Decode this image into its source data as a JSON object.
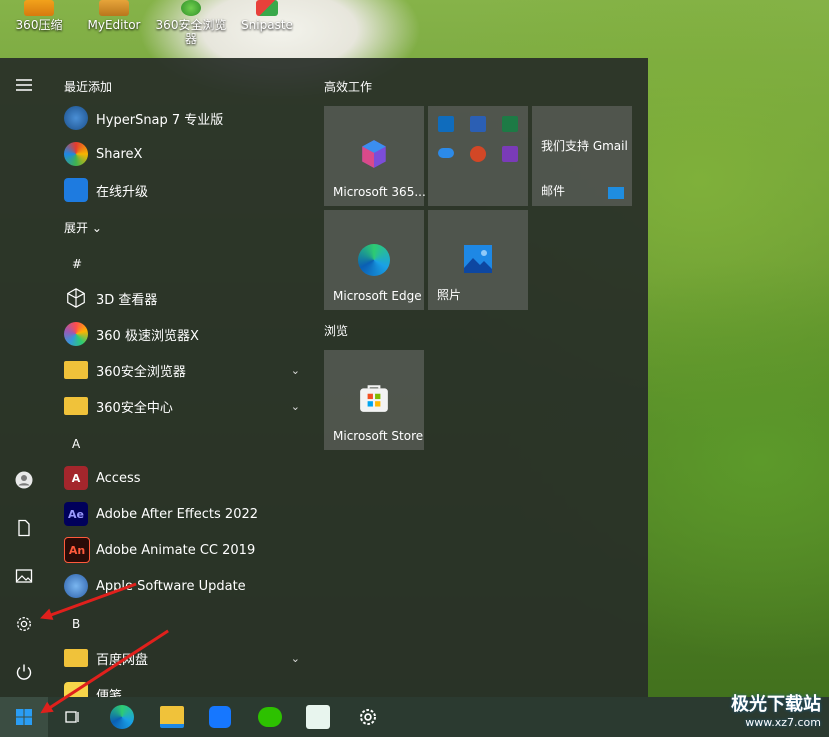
{
  "desktop": {
    "icons": [
      {
        "label": "360压缩",
        "icon": "archive-icon"
      },
      {
        "label": "MyEditor",
        "icon": "editor-icon"
      },
      {
        "label": "360安全浏览器",
        "icon": "browser-icon"
      },
      {
        "label": "Snipaste",
        "icon": "snipaste-icon"
      }
    ]
  },
  "start_menu": {
    "recent_label": "最近添加",
    "recent_apps": [
      {
        "label": "HyperSnap 7 专业版",
        "icon": "hypersnap-icon"
      },
      {
        "label": "ShareX",
        "icon": "sharex-icon"
      },
      {
        "label": "在线升级",
        "icon": "upgrade-icon"
      }
    ],
    "expand_label": "展开",
    "letters": {
      "hash": "#",
      "a": "A",
      "b": "B"
    },
    "apps_hash": [
      {
        "label": "3D 查看器",
        "icon": "cube-icon"
      },
      {
        "label": "360 极速浏览器X",
        "icon": "chrome-like-icon"
      },
      {
        "label": "360安全浏览器",
        "icon": "folder-icon"
      },
      {
        "label": "360安全中心",
        "icon": "folder-icon"
      }
    ],
    "apps_a": [
      {
        "label": "Access",
        "icon": "access-icon",
        "badge": "A"
      },
      {
        "label": "Adobe After Effects 2022",
        "icon": "after-effects-icon",
        "badge": "Ae"
      },
      {
        "label": "Adobe Animate CC 2019",
        "icon": "animate-icon",
        "badge": "An"
      },
      {
        "label": "Apple Software Update",
        "icon": "apple-update-icon"
      }
    ],
    "apps_b": [
      {
        "label": "百度网盘",
        "icon": "folder-icon"
      },
      {
        "label": "便笺",
        "icon": "notes-icon"
      }
    ],
    "groups": {
      "productivity": "高效工作",
      "browse": "浏览"
    },
    "tiles": {
      "m365": "Microsoft 365...",
      "gmail_title": "我们支持 Gmail",
      "mail": "邮件",
      "edge": "Microsoft Edge",
      "photos": "照片",
      "store": "Microsoft Store"
    }
  },
  "watermark": {
    "line1": "极光下载站",
    "line2": "www.xz7.com"
  },
  "colors": {
    "accent": "#0078d4",
    "arrow": "#e0201c"
  }
}
